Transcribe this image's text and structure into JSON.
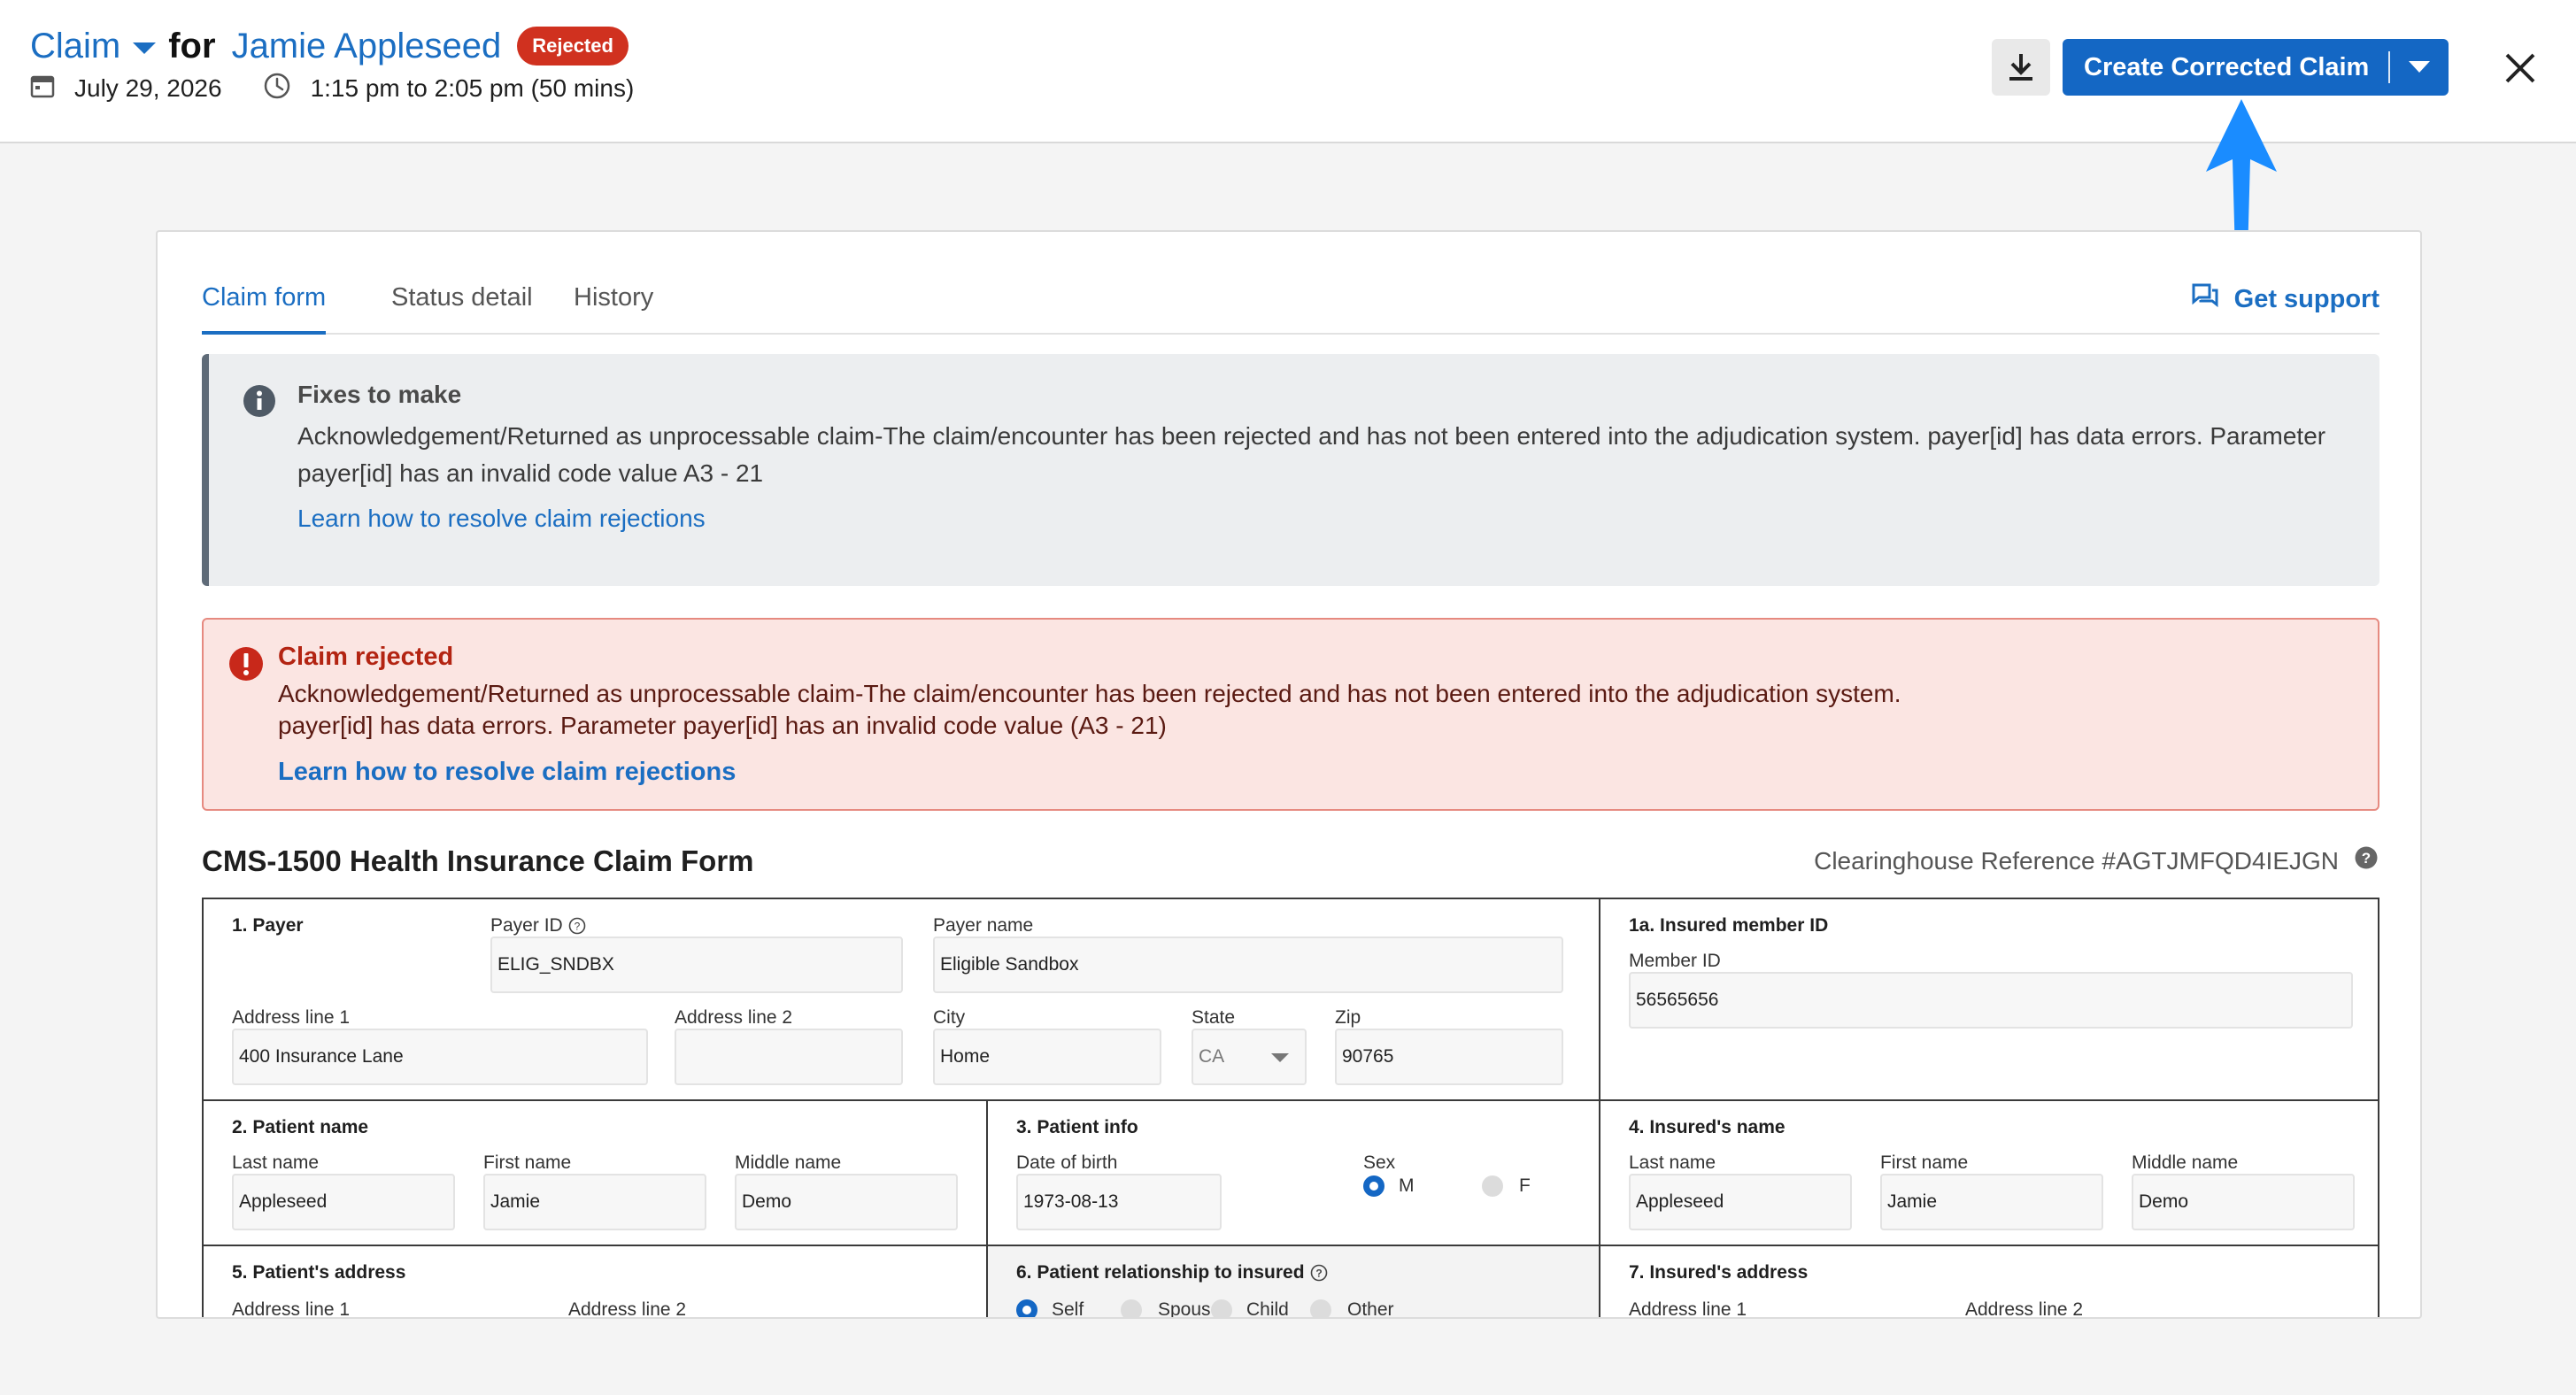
{
  "header": {
    "claim_label": "Claim",
    "for_label": "for",
    "patient_name": "Jamie Appleseed",
    "status_badge": "Rejected",
    "date": "July 29, 2026",
    "time_range": "1:15 pm to 2:05 pm (50 mins)",
    "primary_action": "Create Corrected Claim",
    "icons": [
      "calendar-icon",
      "clock-icon",
      "download-icon",
      "chevron-down-icon",
      "close-icon"
    ],
    "colors": {
      "accent": "#1467c4",
      "badge": "#d0311f",
      "annotation_arrow": "#1a8cff"
    }
  },
  "tabs": [
    {
      "label": "Claim form",
      "active": true
    },
    {
      "label": "Status detail",
      "active": false
    },
    {
      "label": "History",
      "active": false
    }
  ],
  "support_label": "Get support",
  "fixes": {
    "title": "Fixes to make",
    "body": "Acknowledgement/Returned as unprocessable claim-The claim/encounter has been rejected and has not been entered into the adjudication system. payer[id] has data errors. Parameter payer[id] has an invalid code value A3 - 21",
    "link": "Learn how to resolve claim rejections"
  },
  "rejection": {
    "title": "Claim rejected",
    "body_line1": "Acknowledgement/Returned as unprocessable claim-The claim/encounter has been rejected and has not been entered into the adjudication system.",
    "body_line2": "payer[id] has data errors. Parameter payer[id] has an invalid code value (A3 - 21)",
    "link": "Learn how to resolve claim rejections"
  },
  "form": {
    "title": "CMS-1500 Health Insurance Claim Form",
    "reference": "Clearinghouse Reference #AGTJMFQD4IEJGN",
    "payer": {
      "section": "1. Payer",
      "payer_id_label": "Payer ID",
      "payer_id": "ELIG_SNDBX",
      "payer_name_label": "Payer name",
      "payer_name": "Eligible Sandbox",
      "addr1_label": "Address line 1",
      "addr1": "400 Insurance Lane",
      "addr2_label": "Address line 2",
      "addr2": "",
      "city_label": "City",
      "city": "Home",
      "state_label": "State",
      "state": "CA",
      "zip_label": "Zip",
      "zip": "90765"
    },
    "insured_id": {
      "section": "1a. Insured member ID",
      "member_id_label": "Member ID",
      "member_id": "56565656"
    },
    "patient_name": {
      "section": "2. Patient name",
      "last_label": "Last name",
      "last": "Appleseed",
      "first_label": "First name",
      "first": "Jamie",
      "middle_label": "Middle name",
      "middle": "Demo"
    },
    "patient_info": {
      "section": "3. Patient info",
      "dob_label": "Date of birth",
      "dob": "1973-08-13",
      "sex_label": "Sex",
      "sex_m": "M",
      "sex_f": "F",
      "selected": "M"
    },
    "insured_name": {
      "section": "4. Insured's name",
      "last_label": "Last name",
      "last": "Appleseed",
      "first_label": "First name",
      "first": "Jamie",
      "middle_label": "Middle name",
      "middle": "Demo"
    },
    "patient_address": {
      "section": "5. Patient's address",
      "addr1_label": "Address line 1",
      "addr2_label": "Address line 2"
    },
    "relationship": {
      "section": "6. Patient relationship to insured",
      "options": [
        "Self",
        "Spouse",
        "Child",
        "Other"
      ],
      "selected": "Self"
    },
    "insured_address": {
      "section": "7. Insured's address",
      "addr1_label": "Address line 1",
      "addr2_label": "Address line 2"
    }
  }
}
